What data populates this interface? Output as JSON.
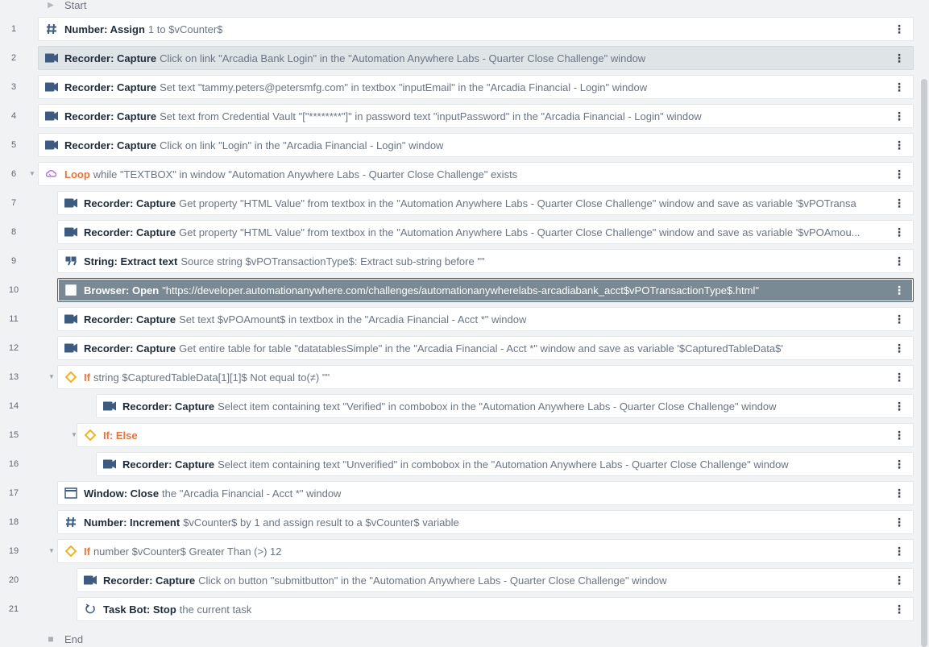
{
  "colors": {
    "canvas": "#f1f2f3",
    "row": "#ffffff",
    "row_hover": "#dfe4e7",
    "row_selected": "#7a8a94",
    "keyword": "#1f2b38",
    "text": "#6b7480",
    "control_keyword": "#e8743b",
    "condition_icon": "#f0b323"
  },
  "flow": {
    "start_label": "Start",
    "end_label": "End",
    "menu_glyph": "⋮",
    "steps": [
      {
        "num": "1",
        "icon": "hash-icon",
        "kw": "Number: Assign",
        "detail": "1 to $vCounter$"
      },
      {
        "num": "2",
        "icon": "camera-icon",
        "kw": "Recorder: Capture",
        "detail": "Click on link \"Arcadia Bank Login\" in the \"Automation Anywhere Labs - Quarter Close Challenge\" window"
      },
      {
        "num": "3",
        "icon": "camera-icon",
        "kw": "Recorder: Capture",
        "detail": "Set text \"tammy.peters@petersmfg.com\" in textbox \"inputEmail\" in the \"Arcadia Financial - Login\" window"
      },
      {
        "num": "4",
        "icon": "camera-icon",
        "kw": "Recorder: Capture",
        "detail": "Set text from Credential Vault \"[\"********\"]\" in password text \"inputPassword\" in the \"Arcadia Financial - Login\" window"
      },
      {
        "num": "5",
        "icon": "camera-icon",
        "kw": "Recorder: Capture",
        "detail": "Click on link \"Login\" in the \"Arcadia Financial - Login\" window"
      },
      {
        "num": "6",
        "icon": "loop-icon",
        "kw": "Loop",
        "detail": "while \"TEXTBOX\" in window \"Automation Anywhere Labs - Quarter Close Challenge\" exists"
      },
      {
        "num": "7",
        "icon": "camera-icon",
        "kw": "Recorder: Capture",
        "detail": "Get property \"HTML Value\" from textbox in the \"Automation Anywhere Labs - Quarter Close Challenge\" window and save as variable '$vPOTransa"
      },
      {
        "num": "8",
        "icon": "camera-icon",
        "kw": "Recorder: Capture",
        "detail": "Get property \"HTML Value\" from textbox in the \"Automation Anywhere Labs - Quarter Close Challenge\" window and save as variable '$vPOAmou..."
      },
      {
        "num": "9",
        "icon": "quote-icon",
        "kw": "String: Extract text",
        "detail": "Source string $vPOTransactionType$: Extract sub-string before \"\""
      },
      {
        "num": "10",
        "icon": "open-external-icon",
        "kw": "Browser: Open",
        "detail": "\"https://developer.automationanywhere.com/challenges/automationanywherelabs-arcadiabank_acct$vPOTransactionType$.html\""
      },
      {
        "num": "11",
        "icon": "camera-icon",
        "kw": "Recorder: Capture",
        "detail": "Set text $vPOAmount$ in textbox in the \"Arcadia Financial - Acct *\" window"
      },
      {
        "num": "12",
        "icon": "camera-icon",
        "kw": "Recorder: Capture",
        "detail": "Get entire table for table \"datatablesSimple\" in the \"Arcadia Financial - Acct *\" window and save as variable '$CapturedTableData$'"
      },
      {
        "num": "13",
        "icon": "condition-icon",
        "kw": "If",
        "detail": "string $CapturedTableData[1][1]$ Not equal to(≠) \"\""
      },
      {
        "num": "14",
        "icon": "camera-icon",
        "kw": "Recorder: Capture",
        "detail": "Select item containing text \"Verified\" in combobox in the \"Automation Anywhere Labs - Quarter Close Challenge\" window"
      },
      {
        "num": "15",
        "icon": "condition-icon",
        "kw": "If: Else",
        "detail": ""
      },
      {
        "num": "16",
        "icon": "camera-icon",
        "kw": "Recorder: Capture",
        "detail": "Select item containing text \"Unverified\" in combobox in the \"Automation Anywhere Labs - Quarter Close Challenge\" window"
      },
      {
        "num": "17",
        "icon": "window-icon",
        "kw": "Window: Close",
        "detail": "the \"Arcadia Financial - Acct *\" window"
      },
      {
        "num": "18",
        "icon": "hash-icon",
        "kw": "Number: Increment",
        "detail": "$vCounter$ by 1 and assign result to a $vCounter$ variable"
      },
      {
        "num": "19",
        "icon": "condition-icon",
        "kw": "If",
        "detail": "number $vCounter$ Greater Than (>) 12"
      },
      {
        "num": "20",
        "icon": "camera-icon",
        "kw": "Recorder: Capture",
        "detail": "Click on button \"submitbutton\" in the \"Automation Anywhere Labs - Quarter Close Challenge\" window"
      },
      {
        "num": "21",
        "icon": "stop-icon",
        "kw": "Task Bot: Stop",
        "detail": "the current task"
      }
    ]
  }
}
